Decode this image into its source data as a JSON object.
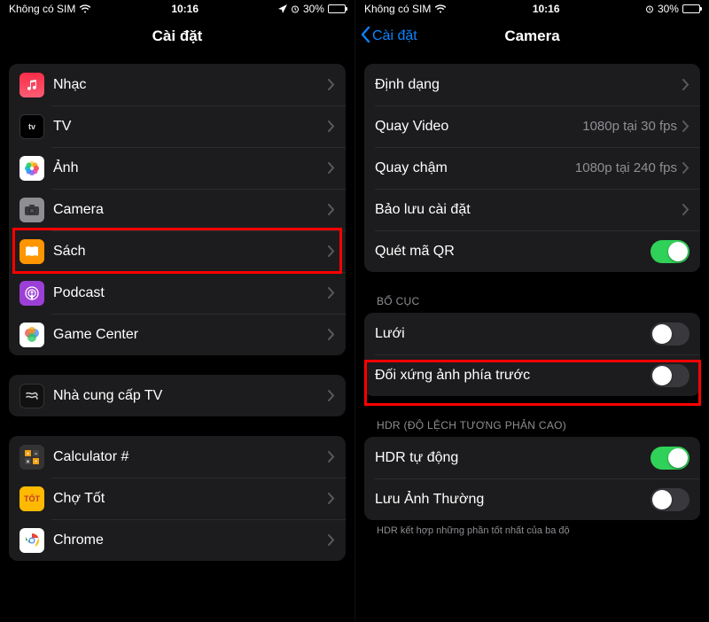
{
  "status": {
    "carrier": "Không có SIM",
    "time": "10:16",
    "battery_pct": "30%"
  },
  "screen1": {
    "title": "Cài đặt",
    "groups": [
      {
        "rows": [
          {
            "key": "music",
            "label": "Nhạc"
          },
          {
            "key": "tv",
            "label": "TV"
          },
          {
            "key": "photos",
            "label": "Ảnh"
          },
          {
            "key": "camera",
            "label": "Camera"
          },
          {
            "key": "books",
            "label": "Sách"
          },
          {
            "key": "podcast",
            "label": "Podcast"
          },
          {
            "key": "gc",
            "label": "Game Center"
          }
        ]
      },
      {
        "rows": [
          {
            "key": "tvprov",
            "label": "Nhà cung cấp TV"
          }
        ]
      },
      {
        "rows": [
          {
            "key": "calc",
            "label": "Calculator #"
          },
          {
            "key": "chotot",
            "label": "Chợ Tốt"
          },
          {
            "key": "chrome",
            "label": "Chrome"
          }
        ]
      }
    ]
  },
  "screen2": {
    "back": "Cài đặt",
    "title": "Camera",
    "group_main": {
      "formats": {
        "label": "Định dạng",
        "value": ""
      },
      "video": {
        "label": "Quay Video",
        "value": "1080p tại 30 fps"
      },
      "slomo": {
        "label": "Quay chậm",
        "value": "1080p tại 240 fps"
      },
      "preserve": {
        "label": "Bảo lưu cài đặt",
        "value": ""
      },
      "qr": {
        "label": "Quét mã QR",
        "on": true
      }
    },
    "section_layout": "BỐ CỤC",
    "group_layout": {
      "grid": {
        "label": "Lưới",
        "on": false
      },
      "mirror": {
        "label": "Đối xứng ảnh phía trước",
        "on": false
      }
    },
    "section_hdr": "HDR (ĐỘ LỆCH TƯƠNG PHẢN CAO)",
    "group_hdr": {
      "auto": {
        "label": "HDR tự động",
        "on": true
      },
      "normal": {
        "label": "Lưu Ảnh Thường",
        "on": false
      }
    },
    "footnote": "HDR kết hợp những phần tốt nhất của ba độ"
  },
  "colors": {
    "accent": "#0a84ff",
    "toggle_on": "#30d158",
    "highlight": "#ff0000"
  }
}
